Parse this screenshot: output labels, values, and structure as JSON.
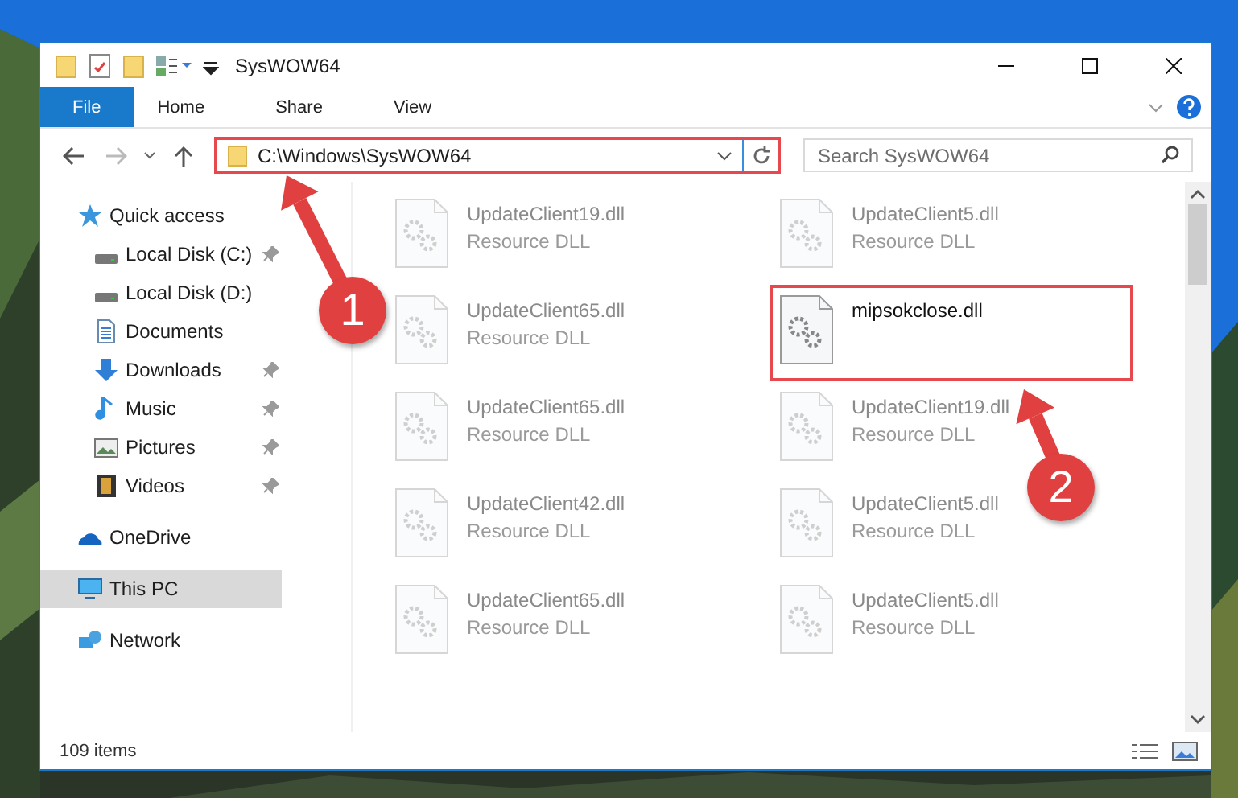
{
  "window": {
    "title": "SysWOW64"
  },
  "ribbon_tabs": [
    {
      "label": "File",
      "kind": "file"
    },
    {
      "label": "Home",
      "kind": "tab"
    },
    {
      "label": "Share",
      "kind": "tab"
    },
    {
      "label": "View",
      "kind": "tab"
    }
  ],
  "address": {
    "path": "C:\\Windows\\SysWOW64",
    "highlighted": true
  },
  "search": {
    "placeholder": "Search SysWOW64"
  },
  "sidebar": {
    "items": [
      {
        "label": "Quick access",
        "kind": "star",
        "selected": false,
        "children": [
          {
            "label": "Local Disk (C:)",
            "kind": "drive",
            "pinned": true,
            "selected": false
          },
          {
            "label": "Local Disk (D:)",
            "kind": "drive",
            "pinned": false,
            "selected": false
          },
          {
            "label": "Documents",
            "kind": "document",
            "pinned": false,
            "selected": false
          },
          {
            "label": "Downloads",
            "kind": "download",
            "pinned": true,
            "selected": false
          },
          {
            "label": "Music",
            "kind": "music",
            "pinned": true,
            "selected": false
          },
          {
            "label": "Pictures",
            "kind": "pictures",
            "pinned": true,
            "selected": false
          },
          {
            "label": "Videos",
            "kind": "videos",
            "pinned": true,
            "selected": false
          }
        ]
      },
      {
        "label": "OneDrive",
        "kind": "cloud",
        "selected": false
      },
      {
        "label": "This PC",
        "kind": "computer",
        "selected": true
      },
      {
        "label": "Network",
        "kind": "network",
        "selected": false
      }
    ]
  },
  "files": [
    {
      "name": "UpdateClient19.dll",
      "type": "Resource DLL",
      "blurred": true,
      "highlighted": false
    },
    {
      "name": "UpdateClient5.dll",
      "type": "Resource DLL",
      "blurred": true,
      "highlighted": false
    },
    {
      "name": "UpdateClient65.dll",
      "type": "Resource DLL",
      "blurred": true,
      "highlighted": false
    },
    {
      "name": "mipsokclose.dll",
      "blurred": false,
      "highlighted": true
    },
    {
      "name": "UpdateClient65.dll",
      "type": "Resource DLL",
      "blurred": true,
      "highlighted": false
    },
    {
      "name": "UpdateClient19.dll",
      "type": "Resource DLL",
      "blurred": true,
      "highlighted": false
    },
    {
      "name": "UpdateClient42.dll",
      "type": "Resource DLL",
      "blurred": true,
      "highlighted": false
    },
    {
      "name": "UpdateClient5.dll",
      "type": "Resource DLL",
      "blurred": true,
      "highlighted": false
    },
    {
      "name": "UpdateClient65.dll",
      "type": "Resource DLL",
      "blurred": true,
      "highlighted": false
    },
    {
      "name": "UpdateClient5.dll",
      "type": "Resource DLL",
      "blurred": true,
      "highlighted": false
    }
  ],
  "callouts": [
    {
      "number": "1"
    },
    {
      "number": "2"
    }
  ],
  "status_bar": {
    "count": "109 items"
  }
}
